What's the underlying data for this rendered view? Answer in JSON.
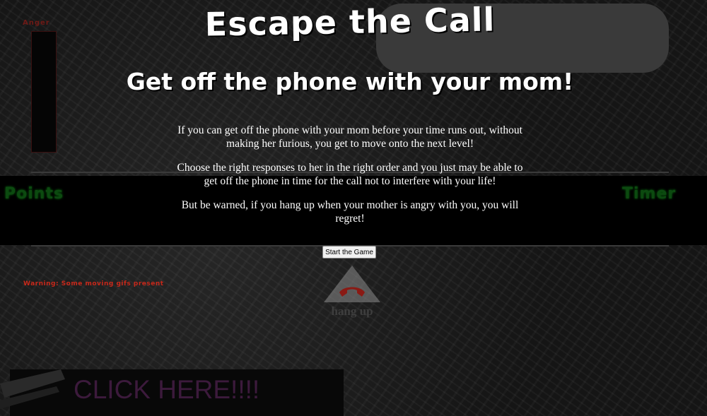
{
  "header": {
    "title": "Escape the Call",
    "subtitle": "Get off the phone with your mom!"
  },
  "hud": {
    "anger_label": "Anger",
    "points_label": "Points",
    "timer_label": "Timer"
  },
  "intro": {
    "paragraphs": [
      "If you can get off the phone with your mom before your time runs out, without making her furious, you get to move onto the next level!",
      "Choose the right responses to her in the right order and you just may be able to get off the phone in time for the call not to interfere with your life!",
      "But be warned, if you hang up when your mother is angry with you, you will regret!"
    ]
  },
  "controls": {
    "start_label": "Start the Game",
    "hangup_label": "hang up",
    "hangup_icon": "phone-hangup-icon"
  },
  "warning": "Warning: Some moving gifs present",
  "ad": {
    "text": "CLICK HERE!!!!"
  },
  "colors": {
    "background": "#141414",
    "bubble": "#3a3a3a",
    "hud_green": "#0c4a10",
    "warning_red": "#c8281a",
    "phone_red": "#8a1a14",
    "ad_text": "#3c1a3c"
  }
}
